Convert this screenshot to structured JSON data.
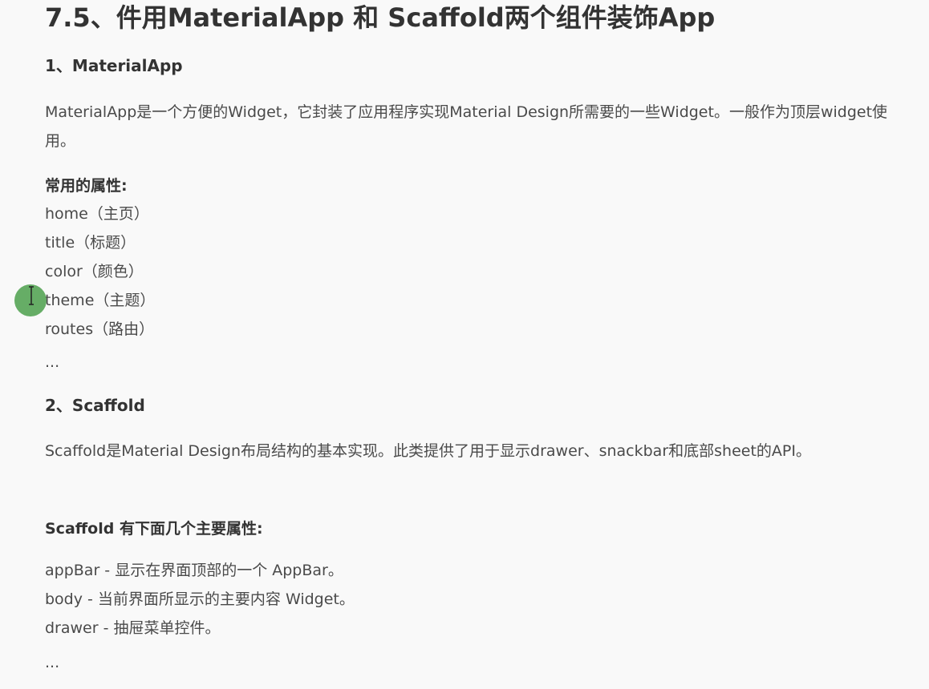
{
  "title": "7.5、件用MaterialApp 和 Scaffold两个组件装饰App",
  "section1": {
    "heading": "1、MaterialApp",
    "description": "MaterialApp是一个方便的Widget，它封装了应用程序实现Material Design所需要的一些Widget。一般作为顶层widget使用。",
    "props_label": "常用的属性:",
    "props": [
      "home（主页）",
      "title（标题）",
      "color（颜色）",
      "theme（主题）",
      "routes（路由）"
    ],
    "more": "..."
  },
  "section2": {
    "heading": "2、Scaffold",
    "description": "Scaffold是Material Design布局结构的基本实现。此类提供了用于显示drawer、snackbar和底部sheet的API。",
    "props_label": "Scaffold 有下面几个主要属性:",
    "props": [
      "appBar - 显示在界面顶部的一个 AppBar。",
      "body - 当前界面所显示的主要内容 Widget。",
      "drawer - 抽屉菜单控件。"
    ],
    "more": "..."
  },
  "colors": {
    "background": "#f9f9f9",
    "text": "#4a4a4a",
    "heading": "#333333",
    "cursor_highlight": "#4ca04c"
  }
}
